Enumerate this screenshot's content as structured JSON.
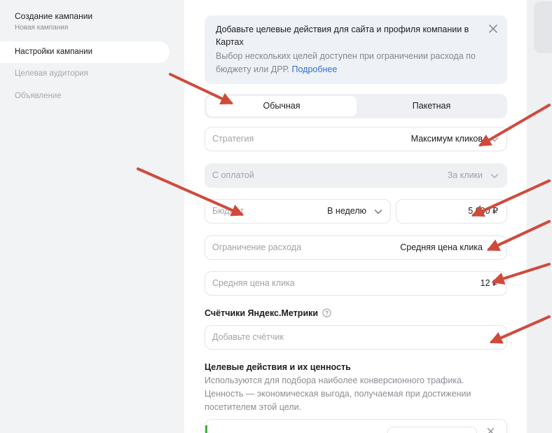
{
  "sidebar": {
    "title": "Создание кампании",
    "subtitle": "Новая кампания",
    "items": [
      {
        "label": "Настройки кампании",
        "active": true
      },
      {
        "label": "Целевая аудитория",
        "active": false
      },
      {
        "label": "Объявление",
        "active": false
      }
    ]
  },
  "banner": {
    "title": "Добавьте целевые действия для сайта и профиля компании в Картах",
    "text": "Выбор нескольких целей доступен при ограничении расхода по бюджету или ДРР.",
    "link": "Подробнее"
  },
  "toggle": {
    "options": [
      "Обычная",
      "Пакетная"
    ],
    "selected": "Обычная"
  },
  "form": {
    "strategy": {
      "label": "Стратегия",
      "value": "Максимум кликов"
    },
    "payment": {
      "label": "С оплатой",
      "value": "За клики"
    },
    "budget": {
      "label": "Бюджет",
      "period": "В неделю",
      "amount": "5 000 ₽"
    },
    "limit": {
      "label": "Ограничение расхода",
      "value": "Средняя цена клика"
    },
    "avg_cpc": {
      "label": "Средняя цена клика",
      "value": "12 ₽"
    },
    "metrika": {
      "title": "Счётчики Яндекс.Метрики",
      "placeholder": "Добавьте счётчик"
    },
    "goals": {
      "title": "Целевые действия и их ценность",
      "description": "Используются для подбора наиболее конверсионного трафика. Ценность — экономическая выгода, получаемая при достижении посетителем этой цели."
    }
  },
  "colors": {
    "accent_link": "#2d6fe0",
    "annotation_arrow": "#d04a3c",
    "goal_accent": "#3db33d"
  }
}
